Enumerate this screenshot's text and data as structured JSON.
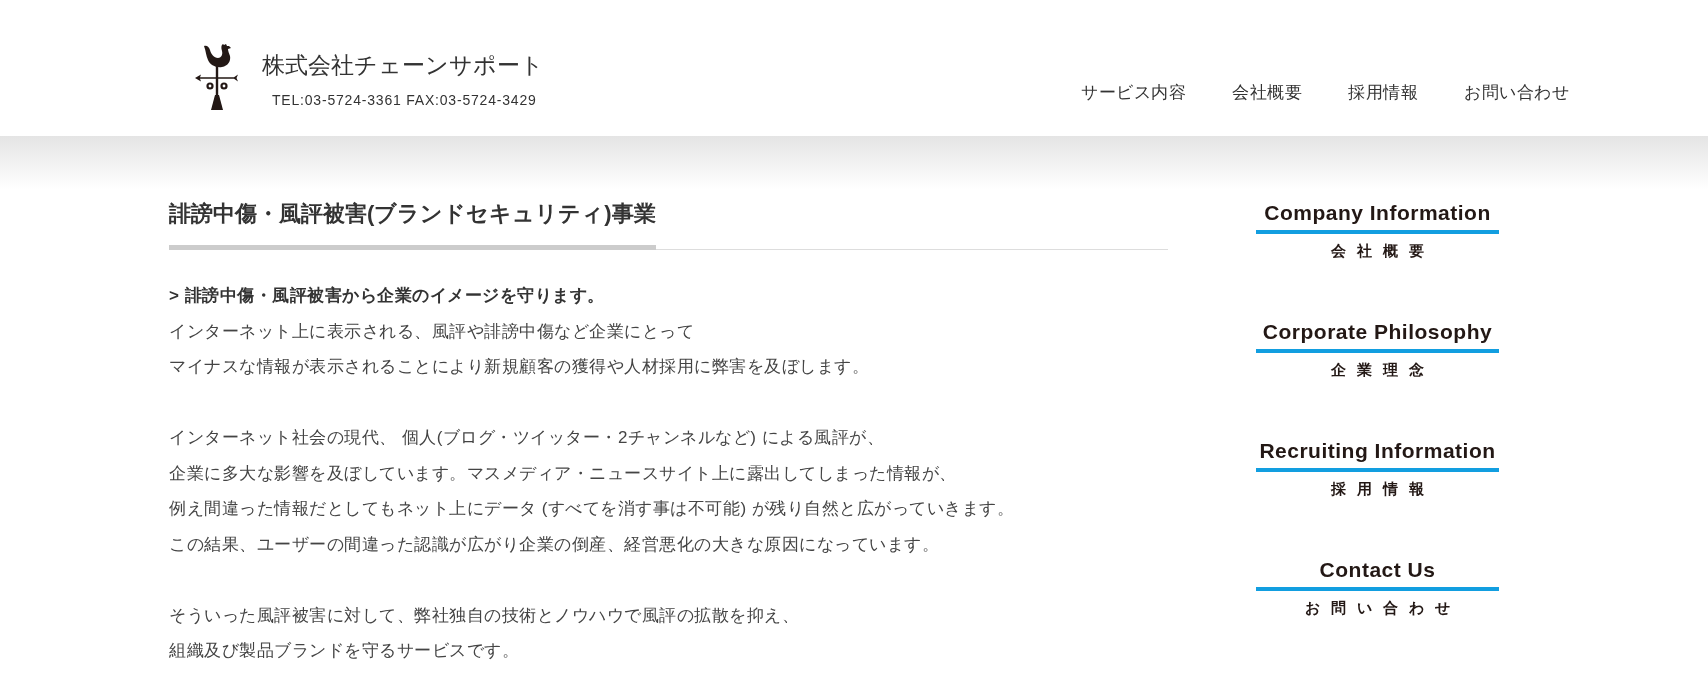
{
  "header": {
    "company_name": "株式会社チェーンサポート",
    "contact_line": "TEL:03-5724-3361 FAX:03-5724-3429",
    "nav": [
      {
        "label": "サービス内容"
      },
      {
        "label": "会社概要"
      },
      {
        "label": "採用情報"
      },
      {
        "label": "お問い合わせ"
      }
    ]
  },
  "article": {
    "title": "誹謗中傷・風評被害(ブランドセキュリティ)事業",
    "lead": "> 誹謗中傷・風評被害から企業のイメージを守ります。",
    "paragraphs": [
      [
        "インターネット上に表示される、風評や誹謗中傷など企業にとって",
        "マイナスな情報が表示されることにより新規顧客の獲得や人材採用に弊害を及ぼします。"
      ],
      [
        "インターネット社会の現代、 個人(ブログ・ツイッター・2チャンネルなど) による風評が、",
        "企業に多大な影響を及ぼしています。マスメディア・ニュースサイト上に露出してしまった情報が、",
        "例え間違った情報だとしてもネット上にデータ (すべてを消す事は不可能) が残り自然と広がっていきます。",
        "この結果、ユーザーの間違った認識が広がり企業の倒産、経営悪化の大きな原因になっています。"
      ],
      [
        "そういった風評被害に対して、弊社独自の技術とノウハウで風評の拡散を抑え、",
        "組織及び製品ブランドを守るサービスです。"
      ]
    ]
  },
  "sidebar": {
    "links": [
      {
        "title": "Company Information",
        "subtitle": "会社概要"
      },
      {
        "title": "Corporate Philosophy",
        "subtitle": "企業理念"
      },
      {
        "title": "Recruiting Information",
        "subtitle": "採用情報"
      },
      {
        "title": "Contact Us",
        "subtitle": "お問い合わせ"
      }
    ]
  }
}
